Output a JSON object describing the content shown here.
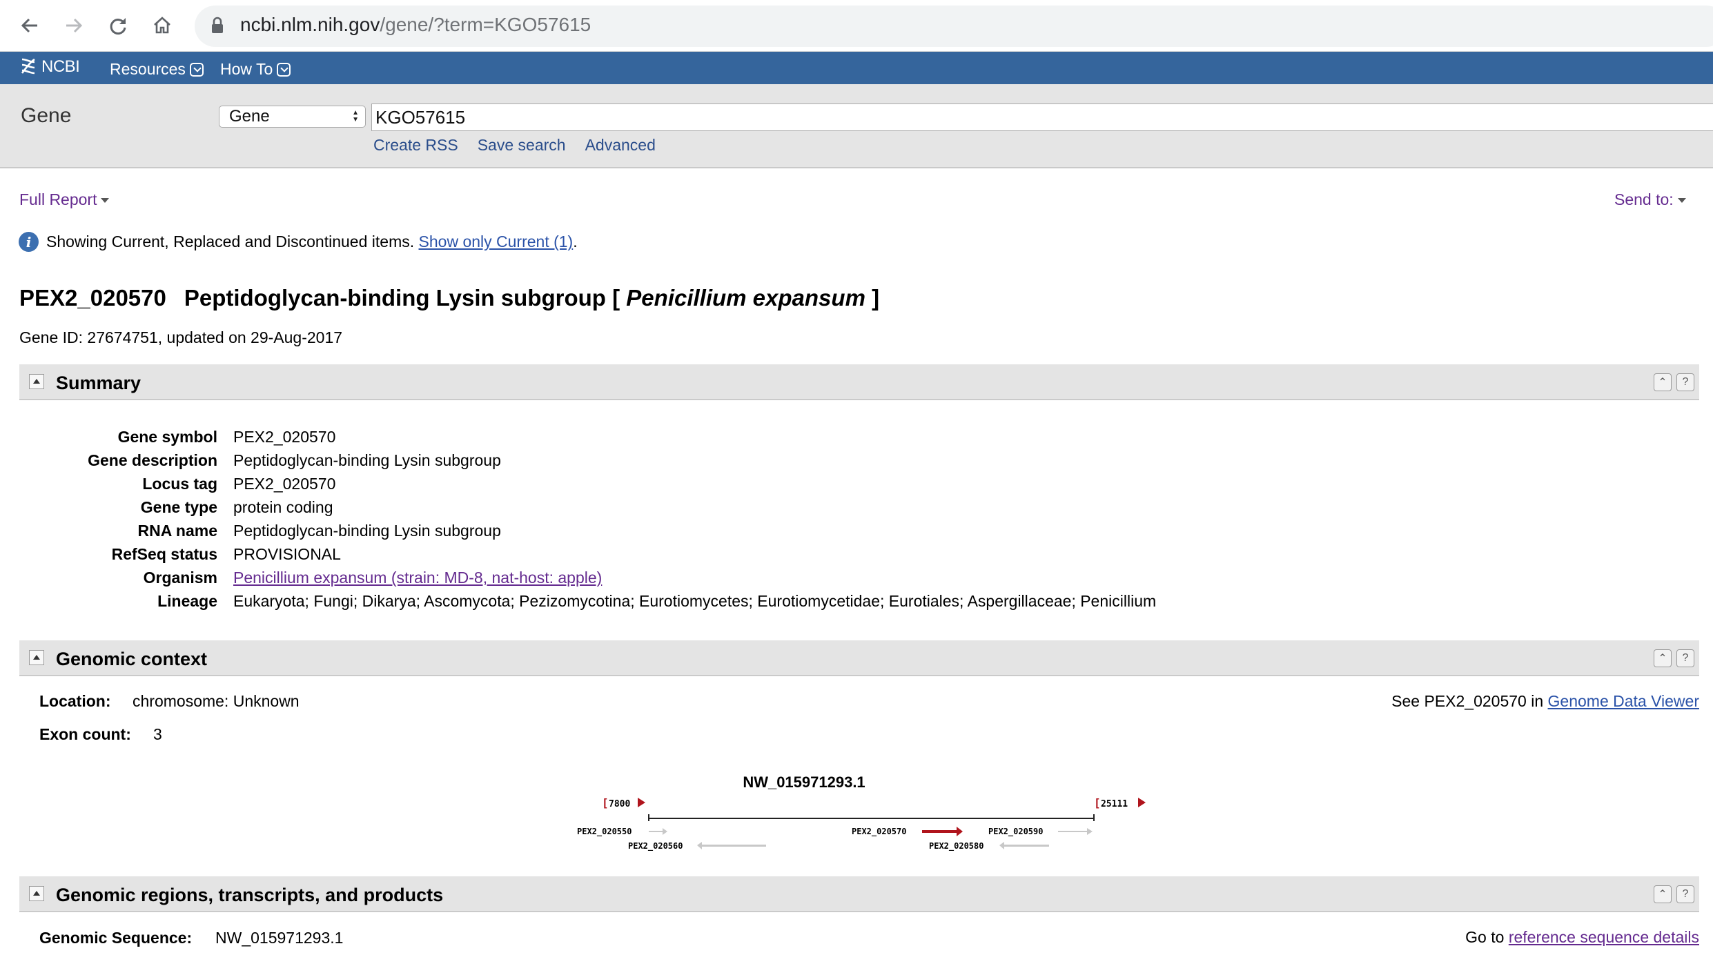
{
  "browser": {
    "url_host": "ncbi.nlm.nih.gov",
    "url_path": "/gene/?term=KGO57615"
  },
  "ncbi_header": {
    "logo_text": "NCBI",
    "menus": [
      "Resources",
      "How To"
    ]
  },
  "search": {
    "database_title": "Gene",
    "database_selected": "Gene",
    "query": "KGO57615",
    "links": [
      "Create RSS",
      "Save search",
      "Advanced"
    ]
  },
  "toolbar": {
    "full_report": "Full Report",
    "send_to": "Send to:"
  },
  "info": {
    "message": "Showing Current, Replaced and Discontinued items.",
    "link_text": "Show only Current (1)",
    "trailing": "."
  },
  "gene": {
    "symbol": "PEX2_020570",
    "description": "Peptidoglycan-binding Lysin subgroup [",
    "organism_italic": "Penicillium expansum",
    "close_bracket": "]",
    "id_line": "Gene ID: 27674751, updated on 29-Aug-2017"
  },
  "summary": {
    "title": "Summary",
    "rows": [
      {
        "label": "Gene symbol",
        "value": "PEX2_020570"
      },
      {
        "label": "Gene description",
        "value": "Peptidoglycan-binding Lysin subgroup"
      },
      {
        "label": "Locus tag",
        "value": "PEX2_020570"
      },
      {
        "label": "Gene type",
        "value": "protein coding"
      },
      {
        "label": "RNA name",
        "value": "Peptidoglycan-binding Lysin subgroup"
      },
      {
        "label": "RefSeq status",
        "value": "PROVISIONAL"
      },
      {
        "label": "Organism",
        "value": "Penicillium expansum (strain: MD-8, nat-host: apple)"
      },
      {
        "label": "Lineage",
        "value": "Eukaryota; Fungi; Dikarya; Ascomycota; Pezizomycotina; Eurotiomycetes; Eurotiomycetidae; Eurotiales; Aspergillaceae; Penicillium"
      }
    ]
  },
  "genomic_context": {
    "title": "Genomic context",
    "location_label": "Location:",
    "location_value": "chromosome: Unknown",
    "exon_label": "Exon count:",
    "exon_value": "3",
    "see_prefix": "See PEX2_020570 in",
    "see_link": "Genome Data Viewer",
    "diagram": {
      "accession": "NW_015971293.1",
      "range_start": "7800",
      "range_end": "25111",
      "genes": [
        "PEX2_020550",
        "PEX2_020560",
        "PEX2_020570",
        "PEX2_020590",
        "PEX2_020580"
      ]
    }
  },
  "regions": {
    "title": "Genomic regions, transcripts, and products",
    "seq_label": "Genomic Sequence:",
    "seq_value": "NW_015971293.1",
    "goto_prefix": "Go to",
    "goto_link": "reference sequence details"
  },
  "colors": {
    "ncbi_blue": "#35659c",
    "link_blue": "#2a52a8",
    "visited_purple": "#642a8f",
    "highlight_red": "#b0141c"
  }
}
